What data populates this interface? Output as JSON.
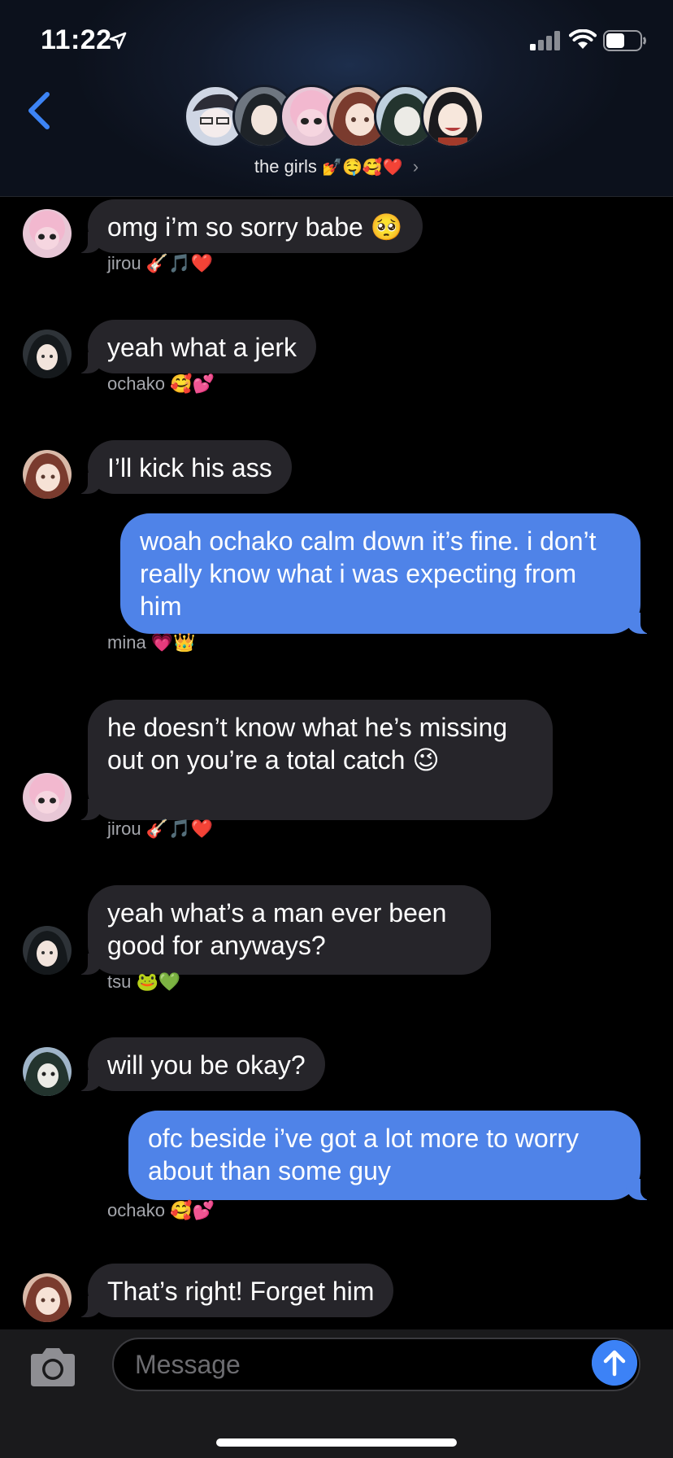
{
  "status_bar": {
    "time": "11:22"
  },
  "header": {
    "group_name": "the girls",
    "group_emojis": "💅🤤🥰❤️",
    "chevron": "›",
    "avatars": [
      {
        "name": "avatar-1",
        "bg": "#cfd6e4"
      },
      {
        "name": "avatar-jirou",
        "bg": "#6e7680"
      },
      {
        "name": "avatar-mina",
        "bg": "#e8c7d6"
      },
      {
        "name": "avatar-ochako",
        "bg": "#d9b9a8"
      },
      {
        "name": "avatar-tsu",
        "bg": "#bfd0de"
      },
      {
        "name": "avatar-momo",
        "bg": "#f0e2d8"
      }
    ]
  },
  "messages": [
    {
      "kind": "in",
      "avatar": "mina",
      "text": "omg i’m so sorry babe 🥺"
    },
    {
      "kind": "sender",
      "name": "jirou",
      "emojis": "🎸🎵❤️"
    },
    {
      "kind": "in",
      "avatar": "jirou",
      "text": "yeah what a jerk"
    },
    {
      "kind": "sender",
      "name": "ochako",
      "emojis": "🥰💕"
    },
    {
      "kind": "in",
      "avatar": "ochako",
      "text": "I’ll kick his ass"
    },
    {
      "kind": "out",
      "text": "woah ochako calm down it’s fine. i don’t really know what i was expecting from him"
    },
    {
      "kind": "sender",
      "name": "mina",
      "emojis": "💗👑"
    },
    {
      "kind": "in",
      "avatar": "mina",
      "text": "he doesn’t know what he’s missing out on you’re a total catch 😉"
    },
    {
      "kind": "sender",
      "name": "jirou",
      "emojis": "🎸🎵❤️"
    },
    {
      "kind": "in",
      "avatar": "jirou",
      "text": "yeah what’s a man ever been good for anyways?"
    },
    {
      "kind": "sender",
      "name": "tsu",
      "emojis": "🐸💚"
    },
    {
      "kind": "in",
      "avatar": "tsu",
      "text": "will you be okay?"
    },
    {
      "kind": "out",
      "text": "ofc beside i’ve got a lot more to worry about than some guy"
    },
    {
      "kind": "sender",
      "name": "ochako",
      "emojis": "🥰💕"
    },
    {
      "kind": "in",
      "avatar": "ochako",
      "text": "That’s right! Forget him"
    }
  ],
  "input_bar": {
    "placeholder": "Message"
  },
  "colors": {
    "incoming_bubble": "#26252a",
    "outgoing_bubble": "#4f83e8",
    "accent": "#3c82f6",
    "avatar_mina": "#e8c7d6",
    "avatar_jirou": "#2e3338",
    "avatar_ochako": "#d9b9a8",
    "avatar_tsu": "#9fb4c8"
  }
}
